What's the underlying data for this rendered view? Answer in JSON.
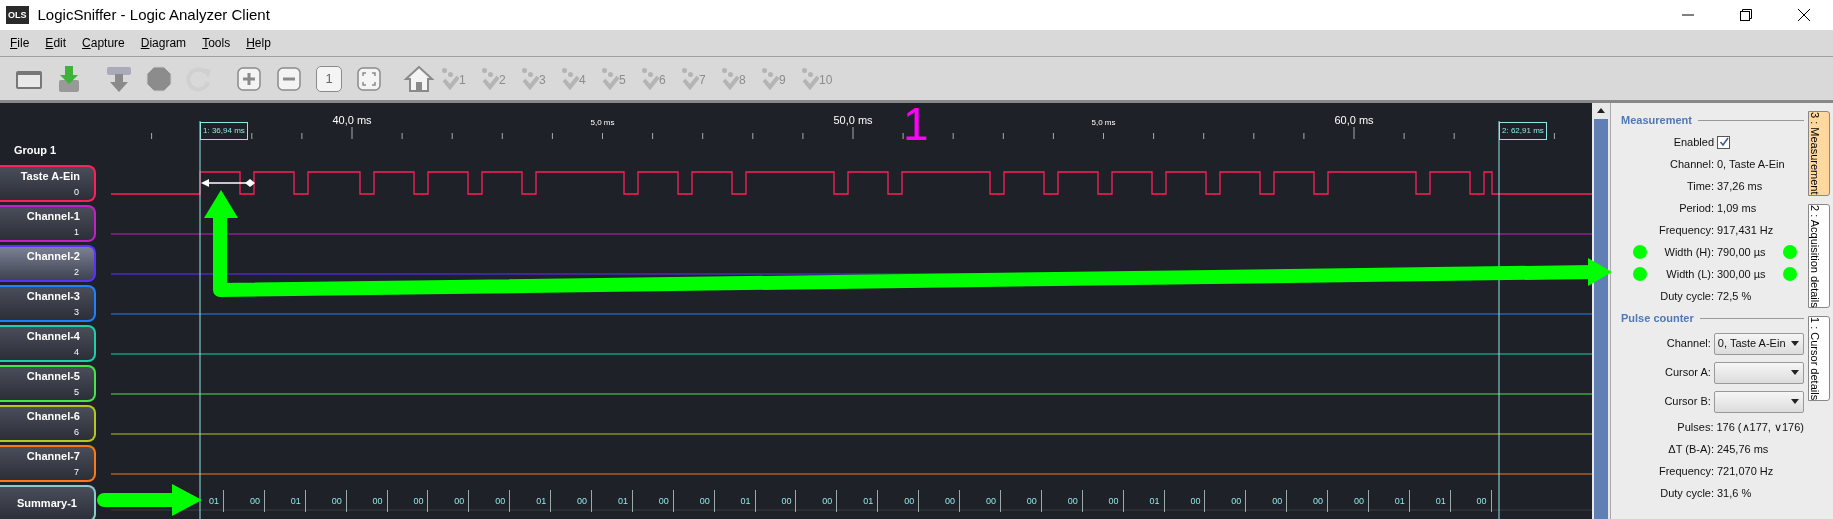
{
  "window": {
    "app_icon": "OLS",
    "title": "LogicSniffer - Logic Analyzer Client"
  },
  "menu": [
    "File",
    "Edit",
    "Capture",
    "Diagram",
    "Tools",
    "Help"
  ],
  "toolbar": [
    {
      "kind": "open",
      "disabled": false
    },
    {
      "kind": "download",
      "disabled": false
    },
    {
      "kind": "capture",
      "disabled": false
    },
    {
      "kind": "stop",
      "disabled": true
    },
    {
      "kind": "repeat",
      "disabled": true
    },
    {
      "kind": "zoom_in",
      "disabled": false
    },
    {
      "kind": "zoom_out",
      "disabled": false
    },
    {
      "kind": "zoom_default",
      "label": "1",
      "disabled": false
    },
    {
      "kind": "zoom_fit",
      "disabled": false
    },
    {
      "kind": "home",
      "disabled": false
    },
    {
      "kind": "cursor",
      "label": "1",
      "disabled": true
    },
    {
      "kind": "cursor",
      "label": "2",
      "disabled": true
    },
    {
      "kind": "cursor",
      "label": "3",
      "disabled": true
    },
    {
      "kind": "cursor",
      "label": "4",
      "disabled": true
    },
    {
      "kind": "cursor",
      "label": "5",
      "disabled": true
    },
    {
      "kind": "cursor",
      "label": "6",
      "disabled": true
    },
    {
      "kind": "cursor",
      "label": "7",
      "disabled": true
    },
    {
      "kind": "cursor",
      "label": "8",
      "disabled": true
    },
    {
      "kind": "cursor",
      "label": "9",
      "disabled": true
    },
    {
      "kind": "cursor",
      "label": "10",
      "disabled": true
    }
  ],
  "waveform": {
    "group": "Group 1",
    "ruler": [
      {
        "label": "40,0 ms",
        "kind": "major"
      },
      {
        "label": "5,0 ms",
        "kind": "minor"
      },
      {
        "label": "50,0 ms",
        "kind": "major"
      },
      {
        "label": "5,0 ms",
        "kind": "minor"
      },
      {
        "label": "60,0 ms",
        "kind": "major"
      }
    ],
    "cursors": [
      {
        "label": "1: 36,94 ms"
      },
      {
        "label": "2: 62,91 ms"
      }
    ],
    "channels": [
      {
        "name": "Taste A-Ein",
        "index": "0",
        "color": "#ff1f5a",
        "selected": false
      },
      {
        "name": "Channel-1",
        "index": "1",
        "color": "#c81ec8",
        "selected": false
      },
      {
        "name": "Channel-2",
        "index": "2",
        "color": "#5a32ff",
        "selected": true
      },
      {
        "name": "Channel-3",
        "index": "3",
        "color": "#1e82ff",
        "selected": false
      },
      {
        "name": "Channel-4",
        "index": "4",
        "color": "#1ecfa8",
        "selected": false
      },
      {
        "name": "Channel-5",
        "index": "5",
        "color": "#46e646",
        "selected": false
      },
      {
        "name": "Channel-6",
        "index": "6",
        "color": "#b4c81e",
        "selected": false
      },
      {
        "name": "Channel-7",
        "index": "7",
        "color": "#ff7814",
        "selected": false
      }
    ],
    "summary": {
      "name": "Summary-1",
      "values": [
        "01",
        "00",
        "01",
        "00",
        "00",
        "00",
        "00",
        "00",
        "01",
        "00",
        "01",
        "00",
        "00",
        "01",
        "00",
        "00",
        "01",
        "00",
        "00",
        "00",
        "00",
        "00",
        "00",
        "01",
        "00",
        "00",
        "00",
        "00",
        "00",
        "01",
        "01",
        "00"
      ]
    }
  },
  "annotation": {
    "label": "1"
  },
  "panel": {
    "measurement": {
      "title": "Measurement",
      "enabled_label": "Enabled",
      "enabled": true,
      "rows": [
        {
          "label": "Channel:",
          "value": "0, Taste A-Ein",
          "marked": false
        },
        {
          "label": "Time:",
          "value": "37,26 ms",
          "marked": false
        },
        {
          "label": "Period:",
          "value": "1,09 ms",
          "marked": false
        },
        {
          "label": "Frequency:",
          "value": "917,431 Hz",
          "marked": false
        },
        {
          "label": "Width (H):",
          "value": "790,00 µs",
          "marked": true
        },
        {
          "label": "Width (L):",
          "value": "300,00 µs",
          "marked": true
        },
        {
          "label": "Duty cycle:",
          "value": "72,5 %",
          "marked": false
        }
      ]
    },
    "pulse_counter": {
      "title": "Pulse counter",
      "rows": [
        {
          "kind": "select",
          "label": "Channel:",
          "value": "0, Taste A-Ein"
        },
        {
          "kind": "select",
          "label": "Cursor A:"
        },
        {
          "kind": "select",
          "label": "Cursor B:"
        },
        {
          "kind": "text",
          "label": "Pulses:",
          "value": "176 (∧177, ∨176)"
        },
        {
          "kind": "text",
          "label": "ΔT (B-A):",
          "value": "245,76 ms"
        },
        {
          "kind": "text",
          "label": "Frequency:",
          "value": "721,070 Hz"
        },
        {
          "kind": "text",
          "label": "Duty cycle:",
          "value": "31,6 %"
        }
      ]
    }
  },
  "tabs": [
    {
      "label": "3 : Measurement",
      "selected": true
    },
    {
      "label": "2 : Acquisition details",
      "selected": false
    },
    {
      "label": "1 : Cursor details",
      "selected": false
    }
  ]
}
